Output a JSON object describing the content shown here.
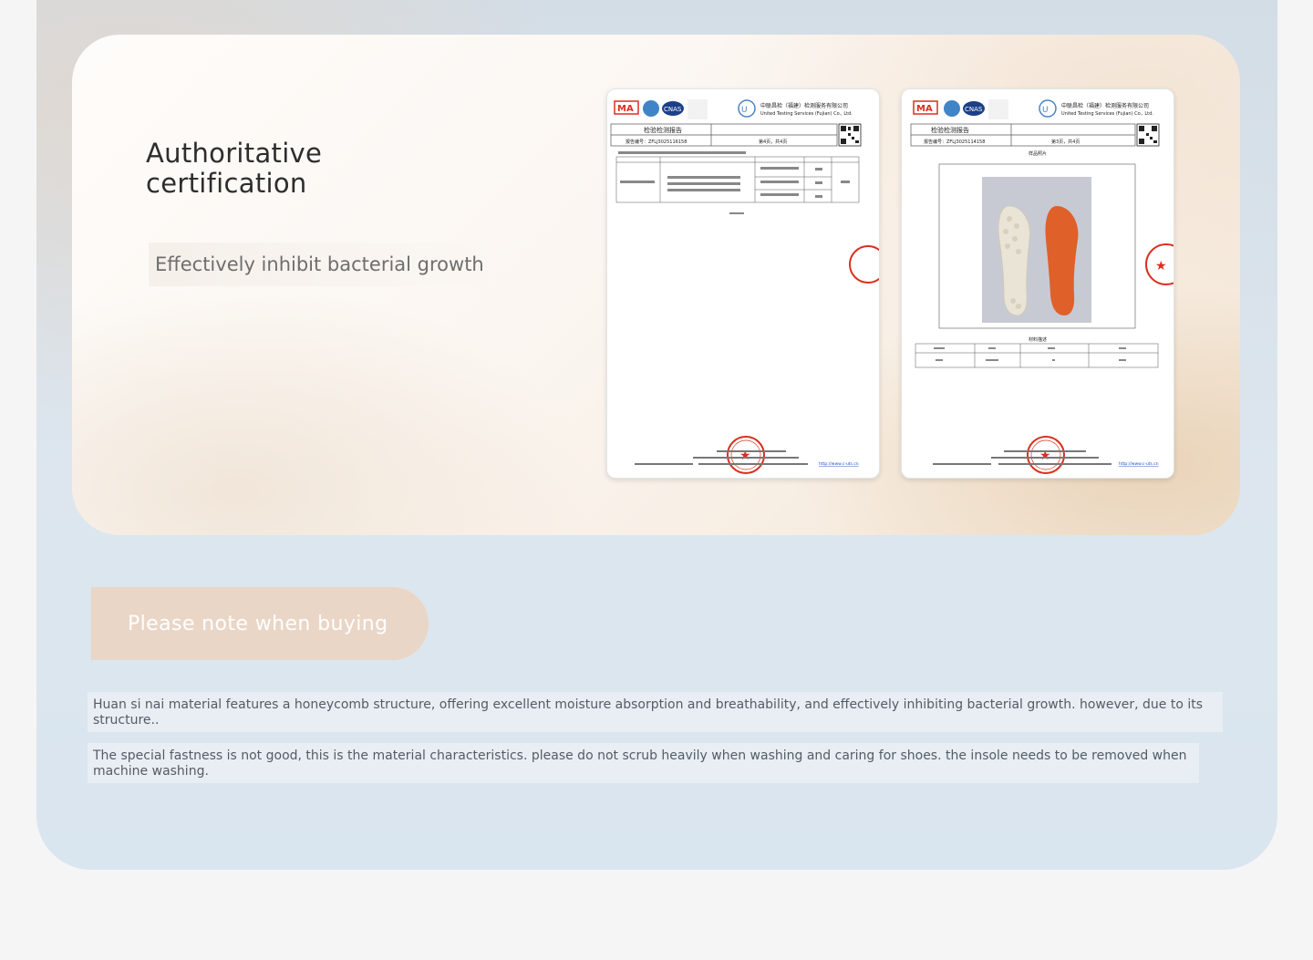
{
  "section": {
    "title": "Authoritative certification",
    "subtitle": "Effectively inhibit bacterial growth"
  },
  "certificates": [
    {
      "header_company_cn": "中联昌检（福建）检测服务有限公司",
      "header_company_en": "United Testing Services (Fujian) Co., Ltd.",
      "report_title": "检验检测报告",
      "report_no": "报告编号：ZFLJ3025116158",
      "page": "第4页，共4页",
      "website": "http://www.c-uts.cn"
    },
    {
      "header_company_cn": "中联昌检（福建）检测服务有限公司",
      "header_company_en": "United Testing Services (Fujian) Co., Ltd.",
      "report_title": "检验检测报告",
      "report_no": "报告编号：ZFLJ3025114158",
      "page": "第3页，共4页",
      "sample_label": "样品照片",
      "material_label": "材料描述",
      "website": "http://www.c-uts.cn"
    }
  ],
  "notes": {
    "heading": "Please note when buying",
    "paragraphs": [
      "Huan si nai material features a honeycomb structure, offering excellent moisture absorption and breathability, and effectively inhibiting bacterial growth. however, due to its structure..",
      "The special fastness is not good, this is the material characteristics. please do not scrub heavily when washing and caring for shoes. the insole needs to be removed when machine washing."
    ]
  },
  "colors": {
    "accent_pill": "#ead6c6",
    "stamp_red": "#d9301f",
    "insole_orange": "#e0602a"
  }
}
